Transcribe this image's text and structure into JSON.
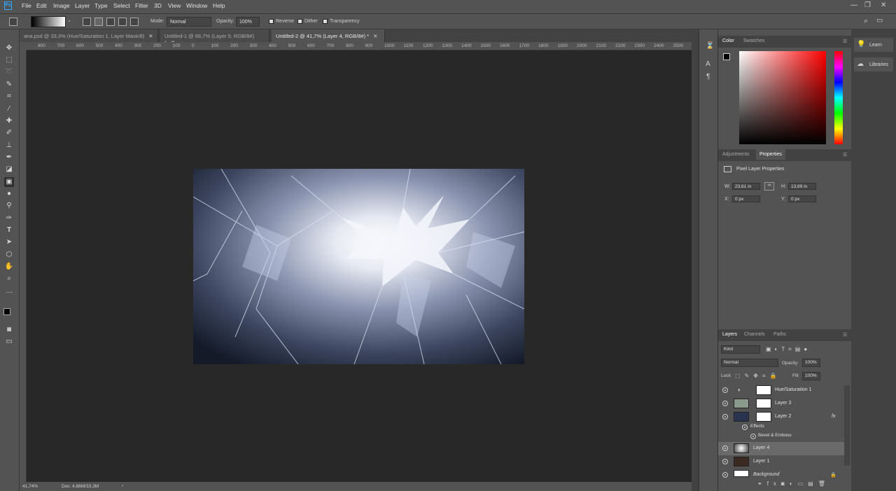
{
  "app": {
    "logo": "Ps"
  },
  "menu": [
    "File",
    "Edit",
    "Image",
    "Layer",
    "Type",
    "Select",
    "Filter",
    "3D",
    "View",
    "Window",
    "Help"
  ],
  "options": {
    "mode_label": "Mode:",
    "mode_value": "Normal",
    "opacity_label": "Opacity:",
    "opacity_value": "100%",
    "reverse_label": "Reverse",
    "dither_label": "Dither",
    "transparency_label": "Transparency"
  },
  "tabs": [
    {
      "label": "ana.psd @ 33,3% (Hue/Saturation 1, Layer Mask/8)"
    },
    {
      "label": "Untitled-1 @ 66,7% (Layer 5, RGB/8#) *"
    },
    {
      "label": "Untitled-2 @ 41,7% (Layer 4, RGB/8#) *"
    }
  ],
  "ruler_ticks": [
    "800",
    "700",
    "600",
    "500",
    "400",
    "300",
    "200",
    "100",
    "0",
    "100",
    "200",
    "300",
    "400",
    "500",
    "600",
    "700",
    "800",
    "900",
    "1000",
    "1100",
    "1200",
    "1300",
    "1400",
    "1500",
    "1600",
    "1700",
    "1800",
    "1900",
    "2000",
    "2100",
    "2200",
    "2300",
    "2400",
    "2500"
  ],
  "status": {
    "zoom": "41,74%",
    "doc": "Doc: 4,86M/33,3M"
  },
  "color_panel": {
    "tabs": [
      "Color",
      "Swatches"
    ]
  },
  "props_panel": {
    "tabs": [
      "Adjustments",
      "Properties"
    ],
    "title": "Pixel Layer Properties",
    "w_label": "W:",
    "w_value": "23,61 in",
    "h_label": "H:",
    "h_value": "13,89 in",
    "x_label": "X:",
    "x_value": "0 px",
    "y_label": "Y:",
    "y_value": "0 px"
  },
  "layers_panel": {
    "tabs": [
      "Layers",
      "Channels",
      "Paths"
    ],
    "kind_label": "Kind",
    "blend_value": "Normal",
    "opacity_label": "Opacity:",
    "opacity_value": "100%",
    "lock_label": "Lock:",
    "fill_label": "Fill:",
    "fill_value": "100%",
    "layers": [
      {
        "name": "Hue/Saturation 1"
      },
      {
        "name": "Layer 3"
      },
      {
        "name": "Layer 2",
        "fx": "fx"
      },
      {
        "name": "Effects"
      },
      {
        "name": "Bevel & Emboss"
      },
      {
        "name": "Layer 4"
      },
      {
        "name": "Layer 1"
      },
      {
        "name": "Background"
      }
    ]
  },
  "right_strip": {
    "learn": "Learn",
    "libraries": "Libraries"
  }
}
